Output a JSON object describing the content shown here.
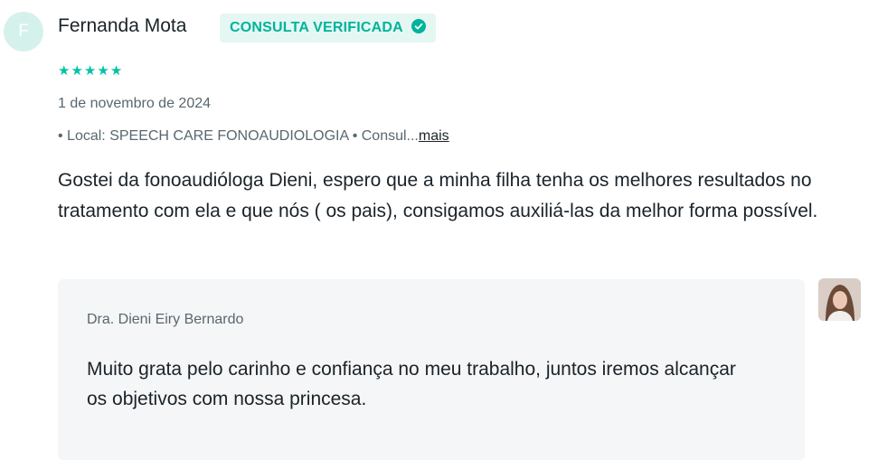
{
  "reviewer": {
    "initial": "F",
    "name": "Fernanda Mota",
    "badge": "CONSULTA VERIFICADA",
    "badge_icon": "check-circle-icon"
  },
  "rating": {
    "stars": 5,
    "max": 5,
    "color": "#00c3a5"
  },
  "date": "1 de novembro de 2024",
  "meta": {
    "text": "• Local: SPEECH CARE FONOAUDIOLOGIA • Consul...",
    "more_label": "mais"
  },
  "review_text": "Gostei da fonoaudióloga Dieni, espero que a minha filha tenha os melhores resultados no tratamento com ela e que nós ( os pais), consigamos auxiliá-las da melhor forma possível.",
  "reply": {
    "author": "Dra. Dieni Eiry Bernardo",
    "text": "Muito grata pelo carinho e confiança no meu trabalho, juntos iremos alcançar os objetivos com nossa princesa."
  },
  "colors": {
    "accent": "#00b39b",
    "badge_bg": "#e5f7f3",
    "avatar_bg": "#d5f1ec",
    "reply_bg": "#f5f6f7"
  }
}
